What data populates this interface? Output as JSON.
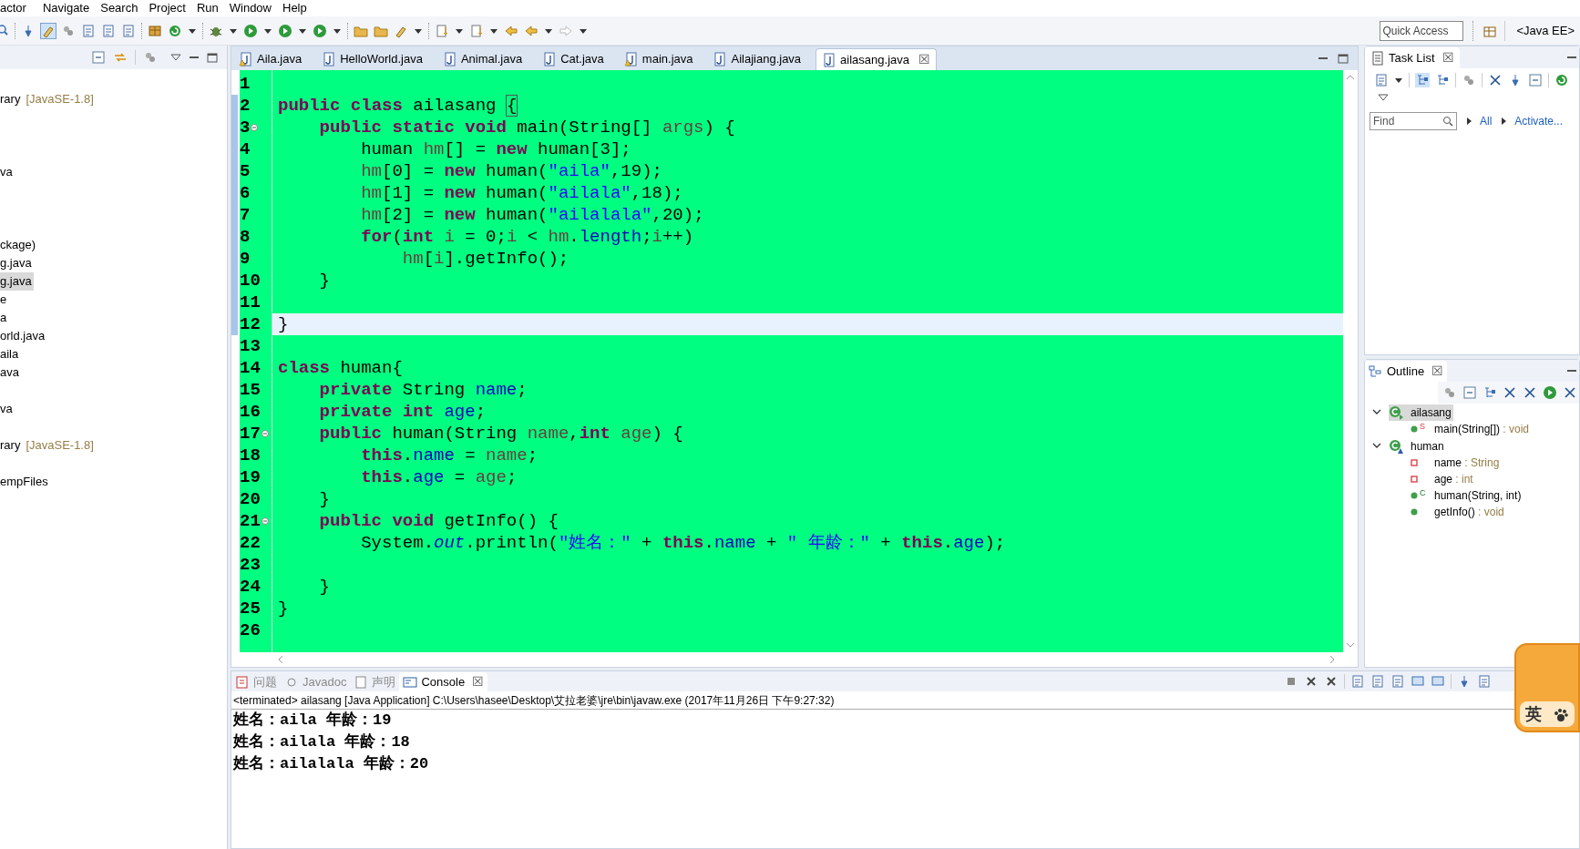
{
  "menu": [
    "actor",
    "Navigate",
    "Search",
    "Project",
    "Run",
    "Window",
    "Help"
  ],
  "quick_access": {
    "placeholder": "Quick Access"
  },
  "perspective": "<Java EE>",
  "explorer": {
    "items": [
      {
        "text": "rary",
        "decoration": "[JavaSE-1.8]",
        "selected": false
      },
      {
        "text": "va",
        "selected": false
      },
      {
        "text": "ckage)",
        "selected": false
      },
      {
        "text": "g.java",
        "selected": false
      },
      {
        "text": "g.java",
        "selected": true
      },
      {
        "text": "e",
        "selected": false
      },
      {
        "text": "a",
        "selected": false
      },
      {
        "text": "orld.java",
        "selected": false
      },
      {
        "text": "aila",
        "selected": false
      },
      {
        "text": "ava",
        "selected": false
      },
      {
        "text": "va",
        "selected": false
      },
      {
        "text": "rary",
        "decoration": "[JavaSE-1.8]",
        "selected": false
      },
      {
        "text": "empFiles",
        "selected": false
      }
    ]
  },
  "editor": {
    "tabs": [
      {
        "label": "Aila.java",
        "warning": true,
        "selected": false
      },
      {
        "label": "HelloWorld.java",
        "warning": false,
        "selected": false
      },
      {
        "label": "Animal.java",
        "warning": false,
        "selected": false
      },
      {
        "label": "Cat.java",
        "warning": false,
        "selected": false
      },
      {
        "label": "main.java",
        "warning": true,
        "selected": false
      },
      {
        "label": "Ailajiang.java",
        "warning": false,
        "selected": false
      },
      {
        "label": "ailasang.java",
        "warning": false,
        "selected": true,
        "close": "☒"
      }
    ],
    "lines": [
      {
        "number": "1"
      },
      {
        "number": "2",
        "tokens": [
          {
            "kind": "keyword",
            "text": "public"
          },
          {
            "kind": "keyword",
            "text": " class"
          },
          {
            "kind": "plain",
            "text": " ailasang "
          },
          {
            "kind": "bracket",
            "text": "{"
          }
        ]
      },
      {
        "number": "3",
        "foldable": true,
        "tokens": [
          {
            "kind": "keyword",
            "text": "    public"
          },
          {
            "kind": "keyword",
            "text": " static"
          },
          {
            "kind": "keyword",
            "text": " void"
          },
          {
            "kind": "plain",
            "text": " main(String[] "
          },
          {
            "kind": "local",
            "text": "args"
          },
          {
            "kind": "plain",
            "text": ") {"
          }
        ]
      },
      {
        "number": "4",
        "tokens": [
          {
            "kind": "plain",
            "text": "        human "
          },
          {
            "kind": "local",
            "text": "hm"
          },
          {
            "kind": "plain",
            "text": "[] = "
          },
          {
            "kind": "keyword",
            "text": "new"
          },
          {
            "kind": "plain",
            "text": " human[3];"
          }
        ]
      },
      {
        "number": "5",
        "tokens": [
          {
            "kind": "local",
            "text": "        hm"
          },
          {
            "kind": "plain",
            "text": "[0] = "
          },
          {
            "kind": "keyword",
            "text": "new"
          },
          {
            "kind": "plain",
            "text": " human("
          },
          {
            "kind": "string",
            "text": "\"aila\""
          },
          {
            "kind": "plain",
            "text": ",19);"
          }
        ]
      },
      {
        "number": "6",
        "tokens": [
          {
            "kind": "local",
            "text": "        hm"
          },
          {
            "kind": "plain",
            "text": "[1] = "
          },
          {
            "kind": "keyword",
            "text": "new"
          },
          {
            "kind": "plain",
            "text": " human("
          },
          {
            "kind": "string",
            "text": "\"ailala\""
          },
          {
            "kind": "plain",
            "text": ",18);"
          }
        ]
      },
      {
        "number": "7",
        "tokens": [
          {
            "kind": "local",
            "text": "        hm"
          },
          {
            "kind": "plain",
            "text": "[2] = "
          },
          {
            "kind": "keyword",
            "text": "new"
          },
          {
            "kind": "plain",
            "text": " human("
          },
          {
            "kind": "string",
            "text": "\"ailalala\""
          },
          {
            "kind": "plain",
            "text": ",20);"
          }
        ]
      },
      {
        "number": "8",
        "tokens": [
          {
            "kind": "keyword",
            "text": "        for"
          },
          {
            "kind": "plain",
            "text": "("
          },
          {
            "kind": "keyword",
            "text": "int"
          },
          {
            "kind": "local",
            "text": " i"
          },
          {
            "kind": "plain",
            "text": " = 0;"
          },
          {
            "kind": "local",
            "text": "i"
          },
          {
            "kind": "plain",
            "text": " < "
          },
          {
            "kind": "local",
            "text": "hm"
          },
          {
            "kind": "plain",
            "text": "."
          },
          {
            "kind": "field",
            "text": "length"
          },
          {
            "kind": "plain",
            "text": ";"
          },
          {
            "kind": "local",
            "text": "i"
          },
          {
            "kind": "plain",
            "text": "++)"
          }
        ]
      },
      {
        "number": "9",
        "tokens": [
          {
            "kind": "local",
            "text": "            hm"
          },
          {
            "kind": "plain",
            "text": "["
          },
          {
            "kind": "local",
            "text": "i"
          },
          {
            "kind": "plain",
            "text": "].getInfo();"
          }
        ]
      },
      {
        "number": "10",
        "tokens": [
          {
            "kind": "plain",
            "text": "    }"
          }
        ]
      },
      {
        "number": "11"
      },
      {
        "number": "12",
        "current": true,
        "tokens": [
          {
            "kind": "plain",
            "text": "}"
          }
        ]
      },
      {
        "number": "13"
      },
      {
        "number": "14",
        "tokens": [
          {
            "kind": "keyword",
            "text": "class"
          },
          {
            "kind": "plain",
            "text": " human{"
          }
        ]
      },
      {
        "number": "15",
        "tokens": [
          {
            "kind": "keyword",
            "text": "    private"
          },
          {
            "kind": "plain",
            "text": " String "
          },
          {
            "kind": "field",
            "text": "name"
          },
          {
            "kind": "plain",
            "text": ";"
          }
        ]
      },
      {
        "number": "16",
        "tokens": [
          {
            "kind": "keyword",
            "text": "    private"
          },
          {
            "kind": "keyword",
            "text": " int"
          },
          {
            "kind": "field",
            "text": " age"
          },
          {
            "kind": "plain",
            "text": ";"
          }
        ]
      },
      {
        "number": "17",
        "foldable": true,
        "tokens": [
          {
            "kind": "keyword",
            "text": "    public"
          },
          {
            "kind": "plain",
            "text": " human(String "
          },
          {
            "kind": "local",
            "text": "name"
          },
          {
            "kind": "plain",
            "text": ","
          },
          {
            "kind": "keyword",
            "text": "int"
          },
          {
            "kind": "local",
            "text": " age"
          },
          {
            "kind": "plain",
            "text": ") {"
          }
        ]
      },
      {
        "number": "18",
        "tokens": [
          {
            "kind": "keyword",
            "text": "        this"
          },
          {
            "kind": "plain",
            "text": "."
          },
          {
            "kind": "field",
            "text": "name"
          },
          {
            "kind": "plain",
            "text": " = "
          },
          {
            "kind": "local",
            "text": "name"
          },
          {
            "kind": "plain",
            "text": ";"
          }
        ]
      },
      {
        "number": "19",
        "tokens": [
          {
            "kind": "keyword",
            "text": "        this"
          },
          {
            "kind": "plain",
            "text": "."
          },
          {
            "kind": "field",
            "text": "age"
          },
          {
            "kind": "plain",
            "text": " = "
          },
          {
            "kind": "local",
            "text": "age"
          },
          {
            "kind": "plain",
            "text": ";"
          }
        ]
      },
      {
        "number": "20",
        "tokens": [
          {
            "kind": "plain",
            "text": "    }"
          }
        ]
      },
      {
        "number": "21",
        "foldable": true,
        "tokens": [
          {
            "kind": "keyword",
            "text": "    public"
          },
          {
            "kind": "keyword",
            "text": " void"
          },
          {
            "kind": "plain",
            "text": " getInfo() {"
          }
        ]
      },
      {
        "number": "22",
        "tokens": [
          {
            "kind": "plain",
            "text": "        System."
          },
          {
            "kind": "static",
            "text": "out"
          },
          {
            "kind": "plain",
            "text": ".println("
          },
          {
            "kind": "string",
            "text": "\"姓名：\""
          },
          {
            "kind": "plain",
            "text": " + "
          },
          {
            "kind": "keyword",
            "text": "this"
          },
          {
            "kind": "plain",
            "text": "."
          },
          {
            "kind": "field",
            "text": "name"
          },
          {
            "kind": "plain",
            "text": " + "
          },
          {
            "kind": "string",
            "text": "\" 年龄：\""
          },
          {
            "kind": "plain",
            "text": " + "
          },
          {
            "kind": "keyword",
            "text": "this"
          },
          {
            "kind": "plain",
            "text": "."
          },
          {
            "kind": "field",
            "text": "age"
          },
          {
            "kind": "plain",
            "text": ");"
          }
        ]
      },
      {
        "number": "23"
      },
      {
        "number": "24",
        "tokens": [
          {
            "kind": "plain",
            "text": "    }"
          }
        ]
      },
      {
        "number": "25",
        "tokens": [
          {
            "kind": "plain",
            "text": "}"
          }
        ]
      },
      {
        "number": "26"
      }
    ]
  },
  "task_list": {
    "tab": {
      "label": "Task List",
      "close": "☒"
    },
    "find": {
      "placeholder": "Find"
    },
    "links": [
      "All",
      "Activate..."
    ]
  },
  "outline": {
    "tab": {
      "label": "Outline",
      "close": "☒"
    },
    "items": [
      {
        "name": "ailasang",
        "kind": "class",
        "expanded": true,
        "selected": true,
        "children": [
          {
            "name": "main(String[])",
            "type": ": void",
            "kind": "method",
            "badge": "S"
          }
        ]
      },
      {
        "name": "human",
        "kind": "class",
        "expanded": true,
        "selected": false,
        "children": [
          {
            "name": "name",
            "type": ": String",
            "kind": "field"
          },
          {
            "name": "age",
            "type": ": int",
            "kind": "field"
          },
          {
            "name": "human(String, int)",
            "kind": "method",
            "badge": "C"
          },
          {
            "name": "getInfo()",
            "type": ": void",
            "kind": "method"
          }
        ]
      }
    ]
  },
  "console": {
    "tabs": [
      {
        "label": "问题",
        "selected": false
      },
      {
        "label": "Javadoc",
        "selected": false
      },
      {
        "label": "声明",
        "selected": false
      },
      {
        "label": "Console",
        "selected": true,
        "close": "☒"
      }
    ],
    "header": "<terminated> ailasang [Java Application] C:\\Users\\hasee\\Desktop\\艾拉老婆\\jre\\bin\\javaw.exe (2017年11月26日 下午9:27:32)",
    "output": [
      "姓名：aila 年龄：19",
      "姓名：ailala 年龄：18",
      "姓名：ailalala 年龄：20"
    ]
  },
  "ime": {
    "label": "英"
  }
}
